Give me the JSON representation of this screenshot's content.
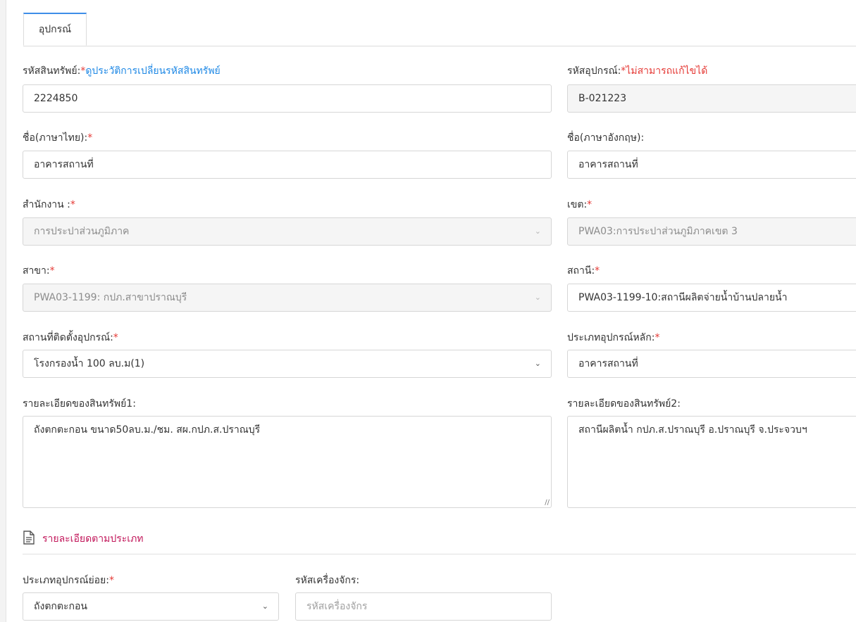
{
  "tab": {
    "label": "อุปกรณ์"
  },
  "fields": {
    "asset_code": {
      "label": "รหัสสินทรัพย์:",
      "req": "*",
      "link": "ดูประวัติการเปลี่ยนรหัสสินทรัพย์",
      "value": "2224850"
    },
    "equipment_code": {
      "label": "รหัสอุปกรณ์:",
      "req": "*",
      "note": "ไม่สามารถแก้ไขได้",
      "value": "B-021223"
    },
    "name_th": {
      "label": "ชื่อ(ภาษาไทย):",
      "req": "*",
      "value": "อาคารสถานที่"
    },
    "name_en": {
      "label": "ชื่อ(ภาษาอังกฤษ):",
      "value": "อาคารสถานที่"
    },
    "office": {
      "label": "สำนักงาน :",
      "req": "*",
      "value": "การประปาส่วนภูมิภาค"
    },
    "region": {
      "label": "เขต:",
      "req": "*",
      "value": "PWA03:การประปาส่วนภูมิภาคเขต 3"
    },
    "branch": {
      "label": "สาขา:",
      "req": "*",
      "value": "PWA03-1199: กปภ.สาขาปราณบุรี"
    },
    "station": {
      "label": "สถานี:",
      "req": "*",
      "value": "PWA03-1199-10:สถานีผลิตจ่ายน้ำบ้านปลายน้ำ"
    },
    "install_location": {
      "label": "สถานที่ติดตั้งอุปกรณ์:",
      "req": "*",
      "value": "โรงกรองน้ำ 100 ลบ.ม(1)"
    },
    "main_type": {
      "label": "ประเภทอุปกรณ์หลัก:",
      "req": "*",
      "value": "อาคารสถานที่"
    },
    "detail1": {
      "label": "รายละเอียดของสินทรัพย์1:",
      "value": "ถังตกตะกอน ขนาด50ลบ.ม./ชม. สผ.กปภ.ส.ปราณบุรี"
    },
    "detail2": {
      "label": "รายละเอียดของสินทรัพย์2:",
      "value": "สถานีผลิตน้ำ กปภ.ส.ปราณบุรี อ.ปราณบุรี จ.ประจวบฯ"
    },
    "sub_type": {
      "label": "ประเภทอุปกรณ์ย่อย:",
      "req": "*",
      "value": "ถังตกตะกอน"
    },
    "machine_code": {
      "label": "รหัสเครื่องจักร:",
      "placeholder": "รหัสเครื่องจักร"
    }
  },
  "section": {
    "title": "รายละเอียดตามประเภท",
    "icon": "document-icon"
  },
  "colors": {
    "accent": "#3d8ee8",
    "required": "#e53935",
    "link": "#1e88e5",
    "section_title": "#c2185b"
  }
}
